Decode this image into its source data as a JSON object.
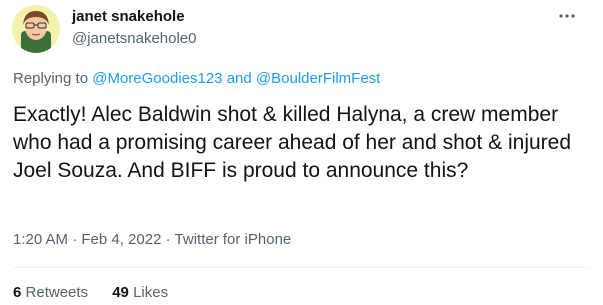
{
  "tweet": {
    "author_name": "janet snakehole",
    "author_handle": "@janetsnakehole0",
    "avatar_icon": "cartoon-avatar",
    "more_icon": "more-horizontal-icon",
    "replying_prefix": "Replying to",
    "mention_1": "@MoreGoodies123",
    "replying_and": "and",
    "mention_2": "@BoulderFilmFest",
    "text": "Exactly! Alec Baldwin shot & killed Halyna, a crew member who had a promising career ahead of her and shot & injured Joel Souza. And BIFF is proud to announce this?",
    "time": "1:20 AM",
    "separator": "·",
    "date": "Feb 4, 2022",
    "source": "Twitter for iPhone",
    "retweets_count": "6",
    "retweets_label": "Retweets",
    "likes_count": "49",
    "likes_label": "Likes"
  },
  "colors": {
    "text_primary": "#0f1419",
    "text_secondary": "#536471",
    "link": "#1d9bf0",
    "divider": "#eff3f4"
  }
}
